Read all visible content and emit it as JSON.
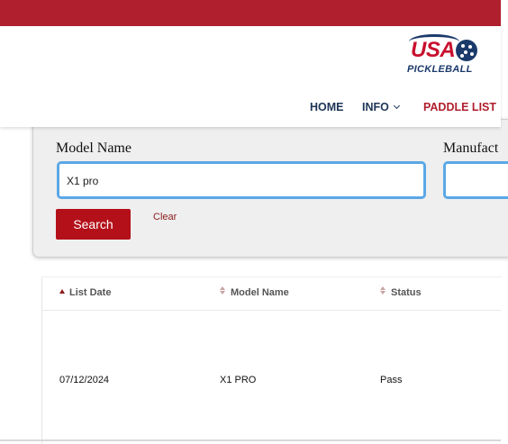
{
  "brand": {
    "logo_word": "USA",
    "logo_sub": "PICKLEBALL"
  },
  "nav": {
    "home": "HOME",
    "info": "INFO",
    "paddle_list": "PADDLE LIST"
  },
  "search": {
    "model_label": "Model Name",
    "model_value": "X1 pro",
    "manufacturer_label": "Manufacturer",
    "manufacturer_value": "",
    "search_button": "Search",
    "clear_link": "Clear"
  },
  "table": {
    "columns": [
      "List Date",
      "Model Name",
      "Status"
    ],
    "rows": [
      {
        "date": "07/12/2024",
        "model": "X1 PRO",
        "status": "Pass"
      }
    ]
  },
  "colors": {
    "brand_red": "#b01f2e",
    "navy": "#1e3557",
    "field_border": "#5ba8e6",
    "button_red": "#b4101a"
  }
}
